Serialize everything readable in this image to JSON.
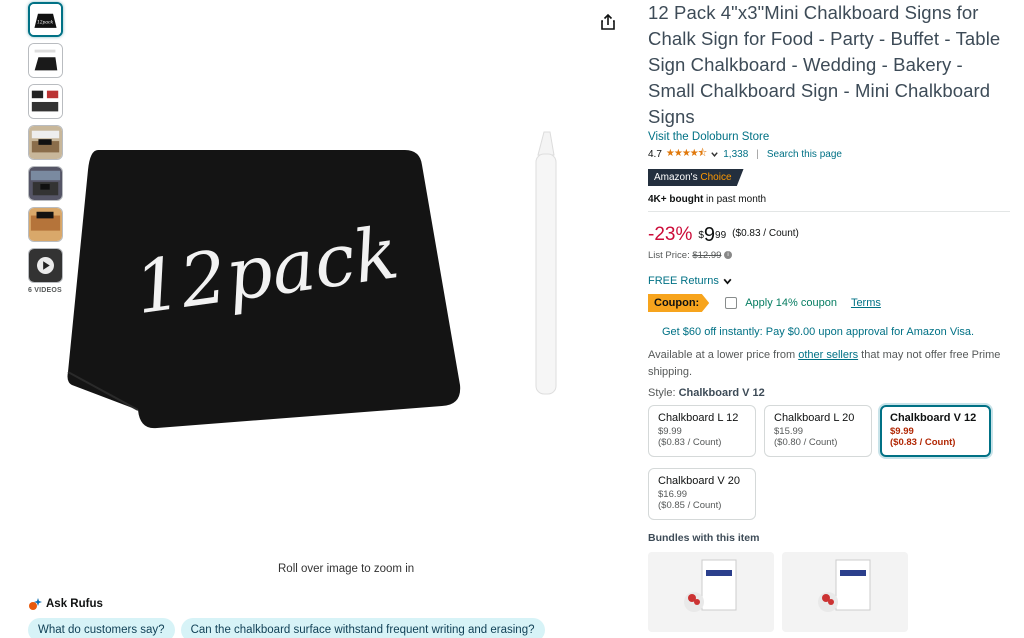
{
  "thumbnails": {
    "items": [
      "thumb-1",
      "thumb-2",
      "thumb-3",
      "thumb-4",
      "thumb-5",
      "thumb-6",
      "thumb-video"
    ],
    "videos_label": "6 VIDEOS"
  },
  "main_image": {
    "chalkboard_text": "12pack",
    "zoom_hint": "Roll over image to zoom in"
  },
  "rufus": {
    "label": "Ask Rufus",
    "chips": [
      "What do customers say?",
      "Can the chalkboard surface withstand frequent writing and erasing?"
    ]
  },
  "product": {
    "title": "12 Pack 4\"x3\"Mini Chalkboard Signs for Chalk Sign for Food - Party - Buffet - Table Sign Chalkboard - Wedding - Bakery - Small Chalkboard Sign - Mini Chalkboard Signs",
    "store_link": "Visit the Doloburn Store",
    "rating": "4.7",
    "stars": "★★★★⯪",
    "review_count": "1,338",
    "search_page": "Search this page",
    "badge_prefix": "Amazon's",
    "badge_choice": "Choice",
    "bought_bold": "4K+ bought",
    "bought_rest": " in past month"
  },
  "price": {
    "discount": "-23%",
    "currency": "$",
    "whole": "9",
    "fraction": "99",
    "unit_price": "($0.83 / Count)",
    "list_price_label": "List Price:",
    "list_price": "$12.99"
  },
  "offers": {
    "free_returns": "FREE Returns",
    "coupon_tag": "Coupon:",
    "coupon_text": "Apply 14% coupon",
    "terms": "Terms",
    "visa": "Get $60 off instantly: Pay $0.00 upon approval for Amazon Visa.",
    "lower_prefix": "Available at a lower price from ",
    "lower_link": "other sellers",
    "lower_suffix": " that may not offer free Prime shipping."
  },
  "style": {
    "label": "Style:",
    "selected": "Chalkboard V 12",
    "options": [
      {
        "name": "Chalkboard L 12",
        "price": "$9.99",
        "unit": "($0.83 / Count)"
      },
      {
        "name": "Chalkboard L 20",
        "price": "$15.99",
        "unit": "($0.80 / Count)"
      },
      {
        "name": "Chalkboard V 12",
        "price": "$9.99",
        "unit": "($0.83 / Count)"
      },
      {
        "name": "Chalkboard V 20",
        "price": "$16.99",
        "unit": "($0.85 / Count)"
      }
    ]
  },
  "bundles": {
    "title": "Bundles with this item"
  },
  "colors": {
    "link": "#007185",
    "deal": "#cc0c39",
    "coupon": "#f7a41d",
    "badge_bg": "#232f3e",
    "badge_choice": "#ff9900"
  }
}
